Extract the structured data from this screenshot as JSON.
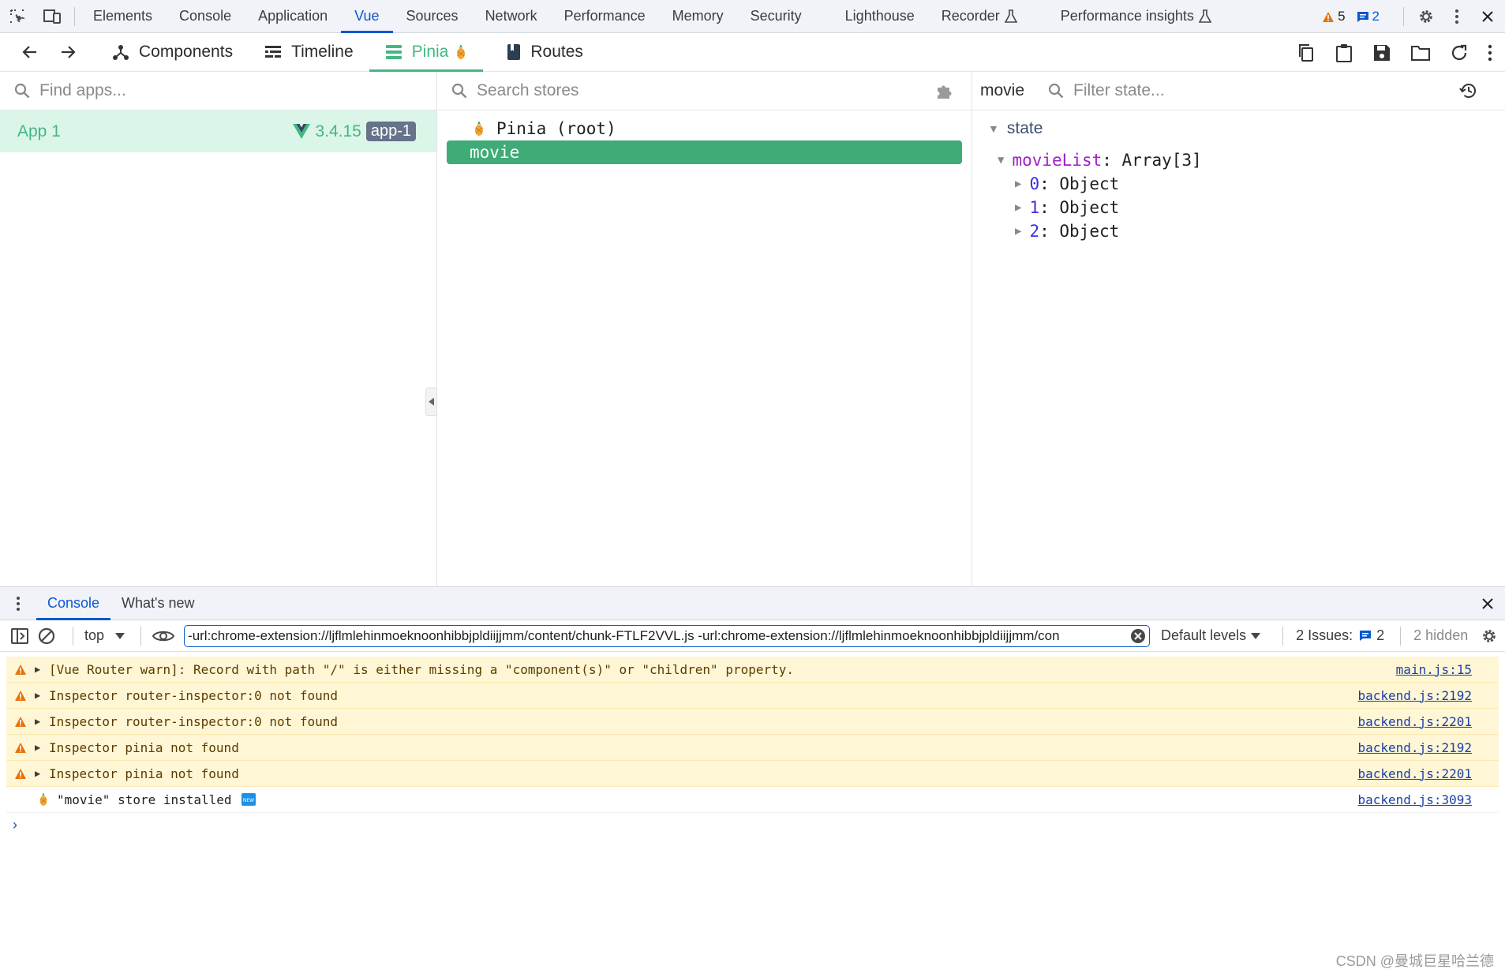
{
  "devtools": {
    "tabs": [
      "Elements",
      "Console",
      "Application",
      "Vue",
      "Sources",
      "Network",
      "Performance",
      "Memory",
      "Security",
      "Lighthouse",
      "Recorder",
      "Performance insights"
    ],
    "active_tab": "Vue",
    "warnings_count": "5",
    "messages_count": "2"
  },
  "vue": {
    "tabs": [
      {
        "label": "Components"
      },
      {
        "label": "Timeline"
      },
      {
        "label": "Pinia"
      },
      {
        "label": "Routes"
      }
    ],
    "active_tab": "Pinia",
    "apps": {
      "search_placeholder": "Find apps...",
      "items": [
        {
          "name": "App 1",
          "version": "3.4.15",
          "id": "app-1"
        }
      ]
    },
    "stores": {
      "search_placeholder": "Search stores",
      "root_label": "Pinia (root)",
      "selected": "movie"
    },
    "state": {
      "store_name": "movie",
      "filter_placeholder": "Filter state...",
      "section": "state",
      "movieList_key": "movieList",
      "movieList_type": "Array[3]",
      "items": [
        {
          "index": "0",
          "type": "Object"
        },
        {
          "index": "1",
          "type": "Object"
        },
        {
          "index": "2",
          "type": "Object"
        }
      ]
    }
  },
  "drawer": {
    "tabs": [
      "Console",
      "What's new"
    ],
    "context": "top",
    "filter_value": "-url:chrome-extension://ljflmlehinmoeknoonhibbjpldiijjmm/content/chunk-FTLF2VVL.js -url:chrome-extension://ljflmlehinmoeknoonhibbjpldiijjmm/con",
    "levels": "Default levels",
    "issues_label": "2 Issues:",
    "issues_count": "2",
    "hidden": "2 hidden"
  },
  "console_messages": [
    {
      "level": "warn",
      "text": "[Vue Router warn]: Record with path \"/\" is either missing a \"component(s)\" or \"children\" property.",
      "source": "main.js:15"
    },
    {
      "level": "warn",
      "text": "Inspector router-inspector:0 not found",
      "source": "backend.js:2192"
    },
    {
      "level": "warn",
      "text": "Inspector router-inspector:0 not found",
      "source": "backend.js:2201"
    },
    {
      "level": "warn",
      "text": "Inspector pinia not found",
      "source": "backend.js:2192"
    },
    {
      "level": "warn",
      "text": "Inspector pinia not found",
      "source": "backend.js:2201"
    },
    {
      "level": "info",
      "text": "\"movie\" store installed",
      "source": "backend.js:3093"
    }
  ],
  "watermark": "CSDN @曼城巨星哈兰德",
  "colors": {
    "vue_green": "#42b883",
    "accent_blue": "#0b57d0",
    "warn_bg": "#fef6d5"
  }
}
